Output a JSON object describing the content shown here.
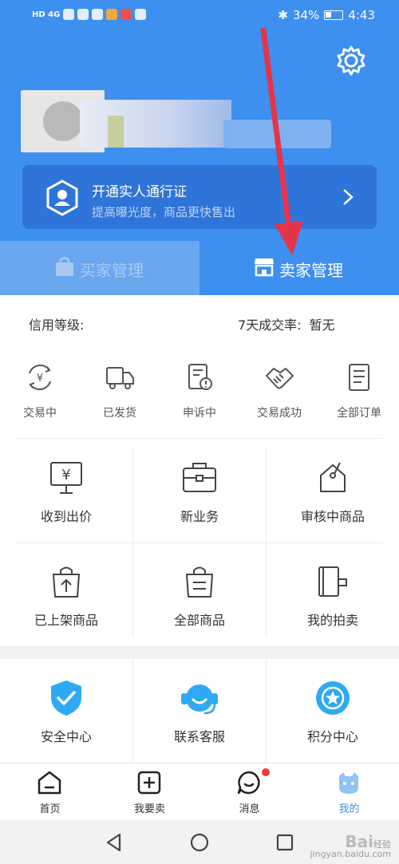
{
  "status_bar": {
    "left_text": "HD 4G",
    "battery": "34%",
    "time": "4:43"
  },
  "profile": {
    "pass_title": "开通实人通行证",
    "pass_subtitle": "提高曝光度，商品更快售出"
  },
  "tabs": [
    {
      "label": "买家管理",
      "active": false
    },
    {
      "label": "卖家管理",
      "active": true
    }
  ],
  "credit": {
    "level_label": "信用等级:",
    "rate_label": "7天成交率:",
    "rate_value": "暂无"
  },
  "orders": [
    {
      "label": "交易中",
      "icon": "yen-cycle-icon"
    },
    {
      "label": "已发货",
      "icon": "truck-icon"
    },
    {
      "label": "申诉中",
      "icon": "doc-alert-icon"
    },
    {
      "label": "交易成功",
      "icon": "handshake-icon"
    },
    {
      "label": "全部订单",
      "icon": "list-doc-icon"
    }
  ],
  "grid": [
    {
      "label": "收到出价",
      "icon": "yen-sign-icon"
    },
    {
      "label": "新业务",
      "icon": "briefcase-icon"
    },
    {
      "label": "审核中商品",
      "icon": "tag-icon"
    },
    {
      "label": "已上架商品",
      "icon": "bag-up-icon"
    },
    {
      "label": "全部商品",
      "icon": "bag-list-icon"
    },
    {
      "label": "我的拍卖",
      "icon": "gavel-icon"
    }
  ],
  "services": [
    {
      "label": "安全中心",
      "icon": "shield-check-icon"
    },
    {
      "label": "联系客服",
      "icon": "headset-icon"
    },
    {
      "label": "积分中心",
      "icon": "star-badge-icon"
    }
  ],
  "nav": [
    {
      "label": "首页",
      "icon": "home-icon",
      "active": false
    },
    {
      "label": "我要卖",
      "icon": "plus-box-icon",
      "active": false
    },
    {
      "label": "消息",
      "icon": "chat-icon",
      "active": false
    },
    {
      "label": "我的",
      "icon": "mascot-icon",
      "active": true
    }
  ],
  "watermark": {
    "brand": "Bai",
    "text": "经验",
    "url": "jingyan.baidu.com"
  },
  "colors": {
    "primary": "#3d8ff0",
    "card": "#2f74d8",
    "annotation": "#e5344a"
  }
}
